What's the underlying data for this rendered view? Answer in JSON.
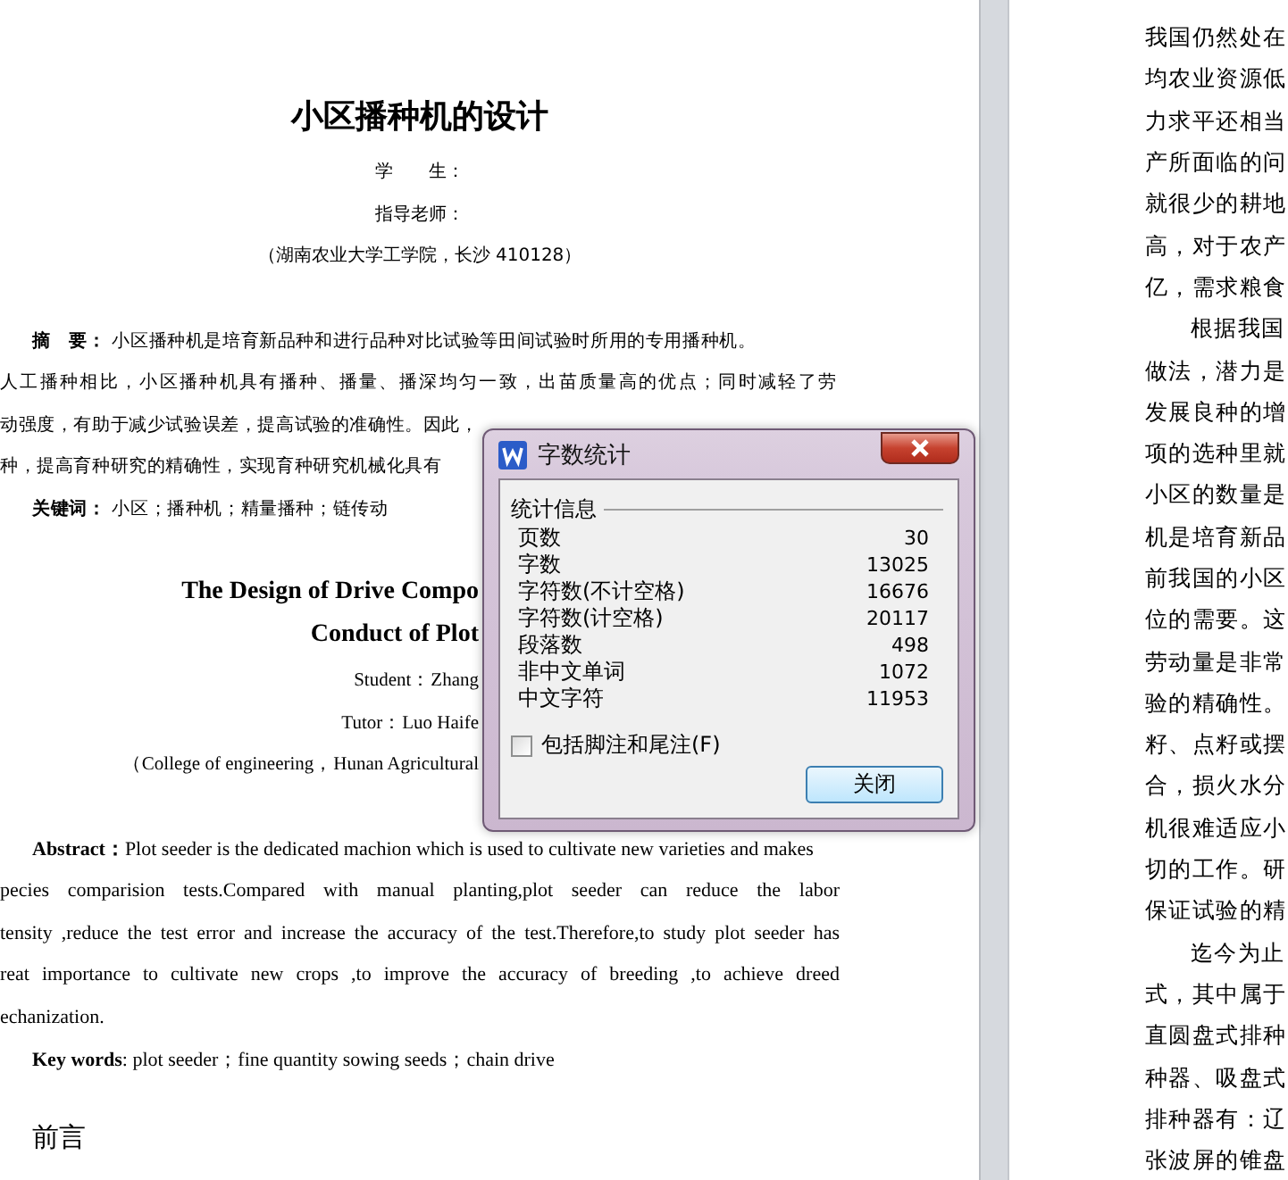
{
  "left_page": {
    "lines": [
      {
        "kind": "title",
        "text": "小区播种机的设计"
      },
      {
        "kind": "meta",
        "text": "学　　生："
      },
      {
        "kind": "meta",
        "text": "指导老师："
      },
      {
        "kind": "meta",
        "text": "（湖南农业大学工学院，长沙 410128）"
      },
      {
        "kind": "cn-abstract",
        "text": "**摘　要：** 小区播种机是培育新品种和进行品种对比试验等田间试验时所用的专用播种机。"
      },
      {
        "kind": "cn-line",
        "text": "人工播种相比，小区播种机具有播种、播量、播深均匀一致，出苗质量高的优点；同时减轻了劳"
      },
      {
        "kind": "cn-cut",
        "text": "动强度，有助于减少试验误差，提高试验的准确性。因此，"
      },
      {
        "kind": "cn-cut",
        "text": "种，提高育种研究的精确性，实现育种研究机械化具有"
      },
      {
        "kind": "cn-keywords",
        "text": "**关键词：** 小区；播种机；精量播种；链传动"
      },
      {
        "kind": "en-title",
        "text": "The Design of Drive Compo"
      },
      {
        "kind": "en-title",
        "text": "Conduct of Plot"
      },
      {
        "kind": "en-meta",
        "text": "Student：Zhang"
      },
      {
        "kind": "en-meta",
        "text": "Tutor：Luo Haife"
      },
      {
        "kind": "en-meta",
        "text": "（College of engineering，Hunan Agricultural"
      },
      {
        "kind": "en-abstract",
        "text": "**Abstract：**Plot seeder is the dedicated machion which is used to cultivate new varieties and makes"
      },
      {
        "kind": "en-line",
        "text": "pecies comparision tests.Compared with manual planting,plot seeder can reduce the labor"
      },
      {
        "kind": "en-line",
        "text": "tensity ,reduce the test error and increase the accuracy of the test.Therefore,to study plot seeder has"
      },
      {
        "kind": "en-line",
        "text": "reat importance to cultivate new crops ,to improve the accuracy of breeding ,to achieve dreed"
      },
      {
        "kind": "en-last",
        "text": "echanization."
      },
      {
        "kind": "en-keywords",
        "text": "**Key words**: plot seeder；fine quantity sowing seeds；chain drive"
      },
      {
        "kind": "heading",
        "text": "前言"
      }
    ]
  },
  "right_page": {
    "lines": [
      {
        "text": "我国仍然处在",
        "indent": false
      },
      {
        "text": "均农业资源低",
        "indent": false
      },
      {
        "text": "力求平还相当",
        "indent": false
      },
      {
        "text": "产所面临的问",
        "indent": false
      },
      {
        "text": "就很少的耕地",
        "indent": false
      },
      {
        "text": "高，对于农产",
        "indent": false
      },
      {
        "text": "亿，需求粮食",
        "indent": false
      },
      {
        "text": "根据我国",
        "indent": true
      },
      {
        "text": "做法，潜力是",
        "indent": false
      },
      {
        "text": "发展良种的增",
        "indent": false
      },
      {
        "text": "项的选种里就",
        "indent": false
      },
      {
        "text": "小区的数量是",
        "indent": false
      },
      {
        "text": "机是培育新品",
        "indent": false
      },
      {
        "text": "前我国的小区",
        "indent": false
      },
      {
        "text": "位的需要。这",
        "indent": false
      },
      {
        "text": "劳动量是非常",
        "indent": false
      },
      {
        "text": "验的精确性。",
        "indent": false
      },
      {
        "text": "籽、点籽或摆",
        "indent": false
      },
      {
        "text": "合，损火水分",
        "indent": false
      },
      {
        "text": "机很难适应小",
        "indent": false
      },
      {
        "text": "切的工作。研",
        "indent": false
      },
      {
        "text": "保证试验的精",
        "indent": false
      },
      {
        "text": "迄今为止",
        "indent": true
      },
      {
        "text": "式，其中属于",
        "indent": false
      },
      {
        "text": "直圆盘式排种",
        "indent": false
      },
      {
        "text": "种器、吸盘式",
        "indent": false
      },
      {
        "text": "排种器有：辽",
        "indent": false
      },
      {
        "text": "张波屏的锥盘",
        "indent": false
      }
    ]
  },
  "dialog": {
    "title": "字数统计",
    "group": "统计信息",
    "stats": [
      {
        "label": "页数",
        "value": "30"
      },
      {
        "label": "字数",
        "value": "13025"
      },
      {
        "label": "字符数(不计空格)",
        "value": "16676"
      },
      {
        "label": "字符数(计空格)",
        "value": "20117"
      },
      {
        "label": "段落数",
        "value": "498"
      },
      {
        "label": "非中文单词",
        "value": "1072"
      },
      {
        "label": "中文字符",
        "value": "11953"
      }
    ],
    "checkbox": {
      "label": "包括脚注和尾注(F)",
      "checked": false
    },
    "close_button": "关闭"
  }
}
